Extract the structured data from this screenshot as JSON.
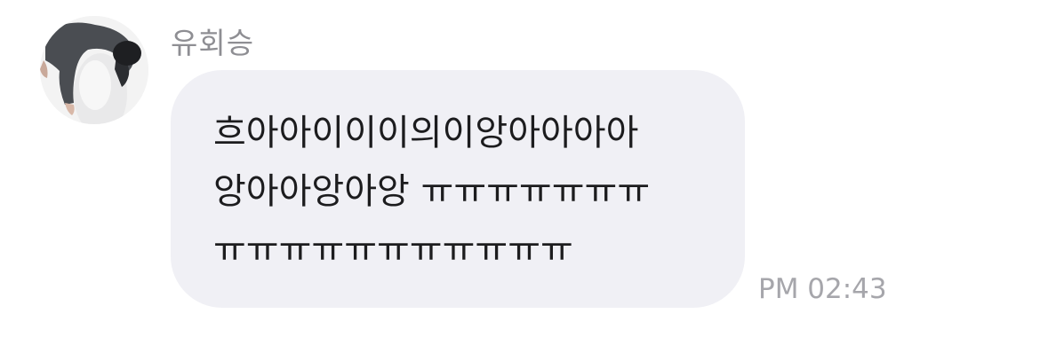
{
  "message": {
    "sender": "유회승",
    "lines": [
      "흐아아이이이의이앙아아아아",
      "앙아아앙아앙 ㅠㅠㅠㅠㅠㅠㅠ",
      "ㅠㅠㅠㅠㅠㅠㅠㅠㅠㅠㅠ"
    ],
    "time": "PM 02:43",
    "avatar": "profile-photo"
  },
  "colors": {
    "bubble": "#f0f0f5",
    "text": "#1c1c1e",
    "sender": "#8e8e93",
    "time": "#a6a6ab"
  }
}
